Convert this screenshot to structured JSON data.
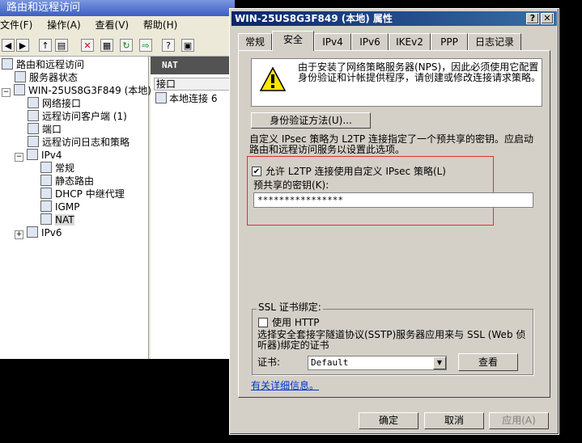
{
  "background_window": {
    "title": "路由和远程访问",
    "menu": [
      "文件(F)",
      "操作(A)",
      "查看(V)",
      "帮助(H)"
    ],
    "tree": [
      {
        "label": "路由和远程访问",
        "level": 0,
        "toggle": ""
      },
      {
        "label": "服务器状态",
        "level": 1,
        "toggle": ""
      },
      {
        "label": "WIN-25US8G3F849 (本地)",
        "level": 0,
        "toggle": "−"
      },
      {
        "label": "网络接口",
        "level": 2,
        "toggle": ""
      },
      {
        "label": "远程访问客户端 (1)",
        "level": 2,
        "toggle": ""
      },
      {
        "label": "端口",
        "level": 2,
        "toggle": ""
      },
      {
        "label": "远程访问日志和策略",
        "level": 2,
        "toggle": ""
      },
      {
        "label": "IPv4",
        "level": 1,
        "toggle": "−"
      },
      {
        "label": "常规",
        "level": 3,
        "toggle": ""
      },
      {
        "label": "静态路由",
        "level": 3,
        "toggle": ""
      },
      {
        "label": "DHCP 中继代理",
        "level": 3,
        "toggle": ""
      },
      {
        "label": "IGMP",
        "level": 3,
        "toggle": ""
      },
      {
        "label": "NAT",
        "level": 3,
        "toggle": ""
      },
      {
        "label": "IPv6",
        "level": 1,
        "toggle": "+"
      }
    ],
    "right_pane": {
      "header": "NAT",
      "column": "接口",
      "rows": [
        "本地连接 6"
      ]
    }
  },
  "dialog": {
    "title": "WIN-25US8G3F849 (本地) 属性",
    "tabs": [
      "常规",
      "安全",
      "IPv4",
      "IPv6",
      "IKEv2",
      "PPP",
      "日志记录"
    ],
    "active_tab": "安全",
    "info_text": "由于安装了网络策略服务器(NPS)，因此必须使用它配置身份验证和计帐提供程序，请创建或修改连接请求策略。",
    "auth_button": "身份验证方法(U)...",
    "ipsec_desc": "自定义 IPsec 策略为 L2TP 连接指定了一个预共享的密钥。应启动路由和远程访问服务以设置此选项。",
    "allow_l2tp_label": "允许 L2TP 连接使用自定义 IPsec 策略(L)",
    "allow_l2tp_checked": true,
    "psk_label": "预共享的密钥(K):",
    "psk_value": "****************",
    "ssl_group_label": "SSL 证书绑定:",
    "use_http_label": "使用 HTTP",
    "use_http_checked": false,
    "sstp_desc": "选择安全套接字隧道协议(SSTP)服务器应用来与 SSL (Web 侦听器)绑定的证书",
    "cert_label": "证书:",
    "cert_value": "Default",
    "view_button": "查看",
    "more_info_link": "有关详细信息。",
    "ok_button": "确定",
    "cancel_button": "取消",
    "apply_button": "应用(A)"
  }
}
